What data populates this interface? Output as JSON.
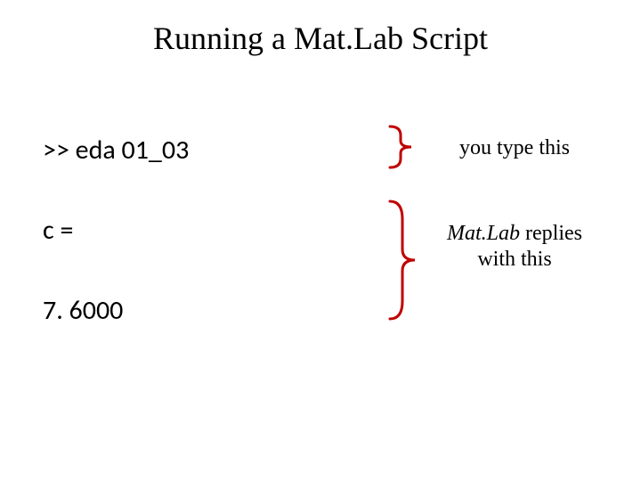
{
  "title": "Running a Mat.Lab Script",
  "console": {
    "input_line": ">> eda 01_03",
    "output_var": "c =",
    "output_val": "7. 6000"
  },
  "annotations": {
    "you_type": "you type this",
    "matlab_word": "Mat.Lab",
    "replies_rest": " replies",
    "with_this": "with this"
  }
}
